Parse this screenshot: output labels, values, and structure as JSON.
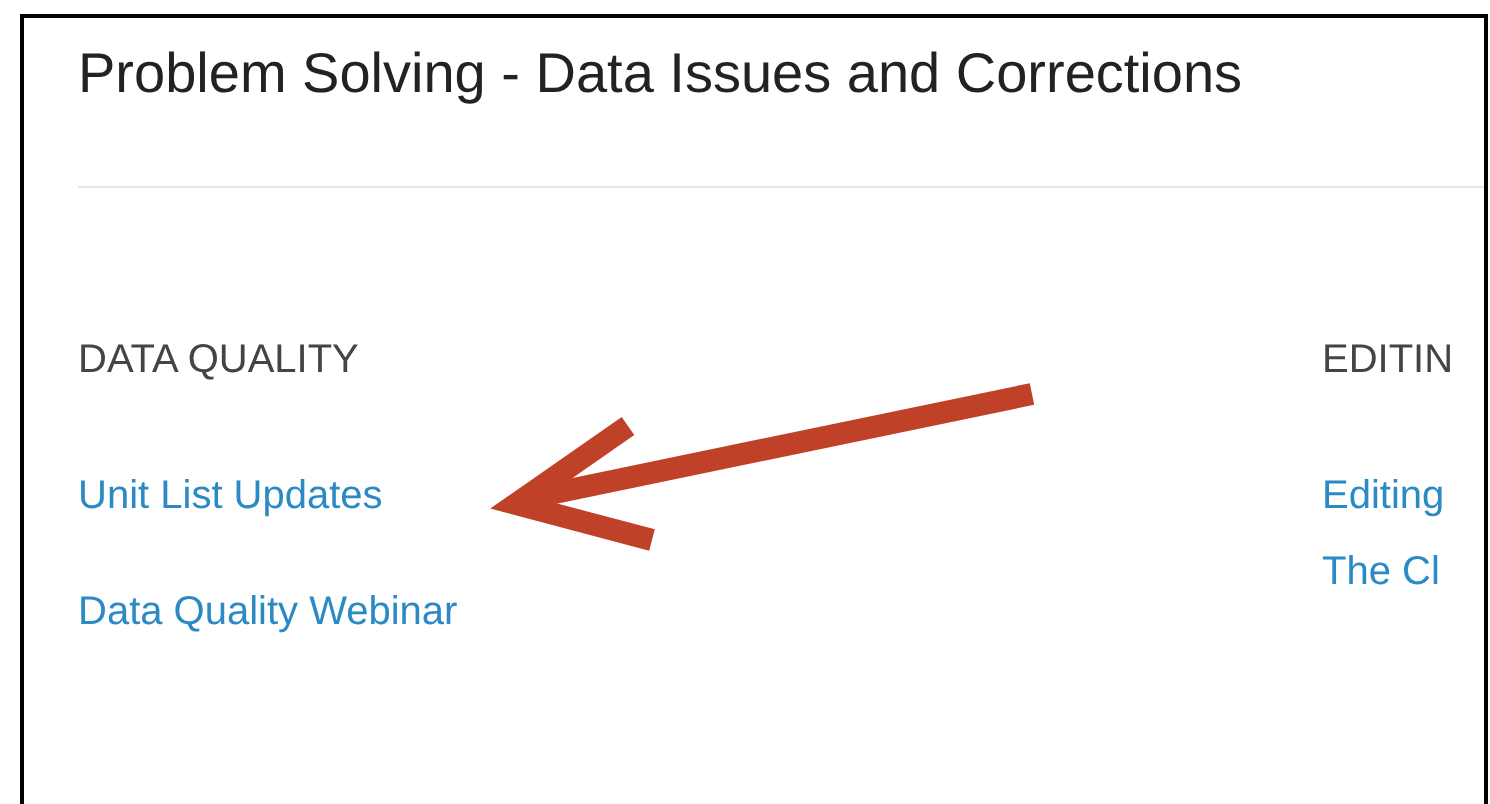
{
  "page_title": "Problem Solving - Data Issues and Corrections",
  "columns": [
    {
      "heading": "DATA QUALITY",
      "links": [
        "Unit List Updates",
        "Data Quality Webinar"
      ]
    },
    {
      "heading": "EDITIN",
      "links": [
        "Editing",
        "The Cl"
      ]
    }
  ],
  "annotation": {
    "kind": "arrow"
  }
}
